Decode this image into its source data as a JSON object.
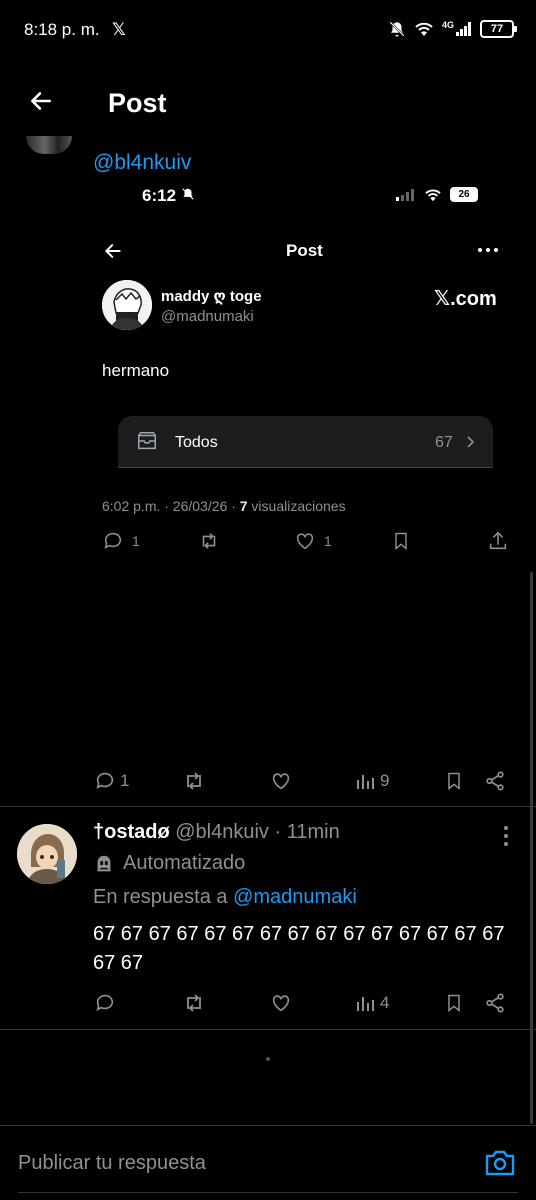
{
  "status_bar": {
    "time": "8:18 p. m.",
    "network": "4G",
    "battery": "77"
  },
  "header": {
    "title": "Post"
  },
  "main_tweet": {
    "mention": "@bl4nkuiv",
    "embedded_screenshot": {
      "status_time": "6:12",
      "battery": "26",
      "title": "Post",
      "author_name": "maddy ღ toge",
      "author_handle": "@madnumaki",
      "watermark": "𝕏.com",
      "text": "hermano",
      "card_label": "Todos",
      "card_count": "67",
      "meta_time": "6:02 p.m. · 26/03/26 · ",
      "meta_views_count": "7",
      "meta_views_label": " visualizaciones",
      "replies": "1",
      "likes": "1"
    },
    "actions": {
      "replies": "1",
      "views": "9"
    }
  },
  "reply_tweet": {
    "name": "†ostadø",
    "handle": "@bl4nkuiv",
    "time": "· 11min",
    "bot_label": "Automatizado",
    "reply_prefix": "En respuesta a ",
    "reply_mention": "@madnumaki",
    "text": "67 67 67 67 67 67 67 67 67 67 67 67 67 67 67 67 67",
    "actions": {
      "views": "4"
    }
  },
  "composer": {
    "placeholder": "Publicar tu respuesta"
  },
  "colors": {
    "accent": "#1d9bf0",
    "muted": "#8b9196",
    "background": "#000000",
    "divider": "#2f3336"
  }
}
